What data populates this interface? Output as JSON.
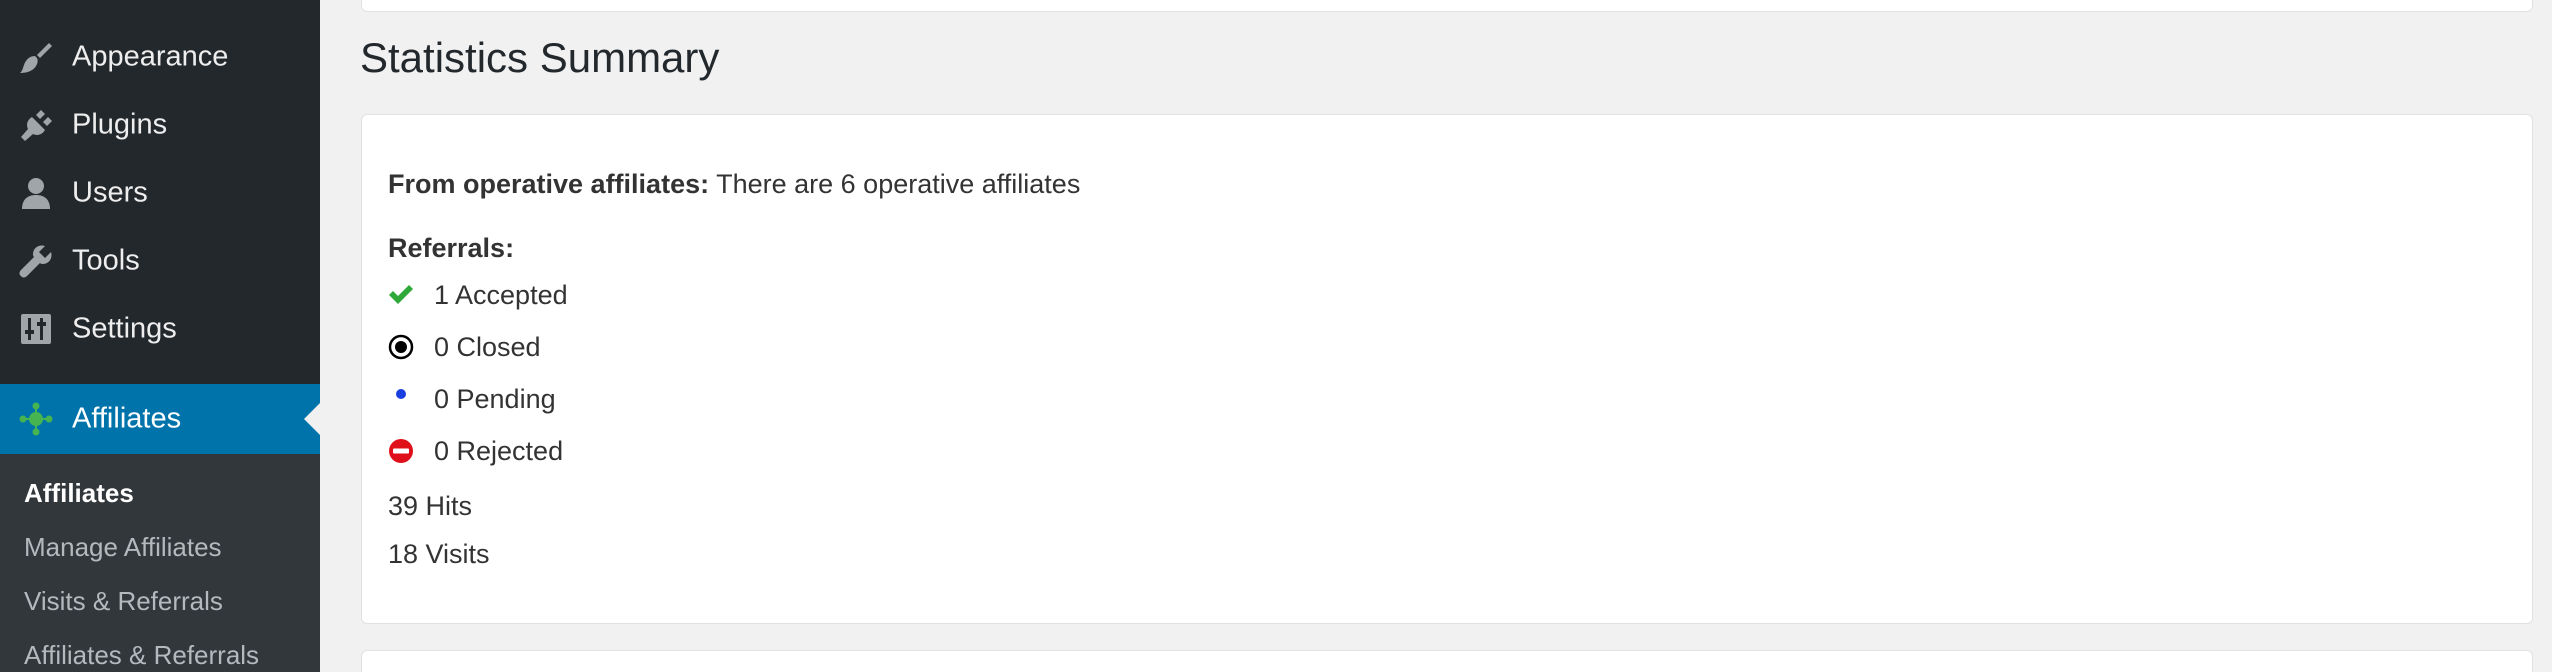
{
  "sidebar": {
    "menu": [
      {
        "label": "Appearance",
        "icon": "paintbrush-icon"
      },
      {
        "label": "Plugins",
        "icon": "plug-icon"
      },
      {
        "label": "Users",
        "icon": "user-icon"
      },
      {
        "label": "Tools",
        "icon": "wrench-icon"
      },
      {
        "label": "Settings",
        "icon": "settings-sliders-icon"
      }
    ],
    "active": {
      "label": "Affiliates",
      "icon": "affiliates-network-icon"
    },
    "submenu": [
      {
        "label": "Affiliates",
        "current": true
      },
      {
        "label": "Manage Affiliates"
      },
      {
        "label": "Visits & Referrals"
      },
      {
        "label": "Affiliates & Referrals"
      }
    ]
  },
  "main": {
    "title": "Statistics Summary",
    "operative": {
      "label": "From operative affiliates:",
      "text": "There are 6 operative affiliates"
    },
    "referrals": {
      "label": "Referrals:",
      "statuses": [
        {
          "text": "1 Accepted",
          "icon": "check-icon",
          "color": "#2ea836"
        },
        {
          "text": "0 Closed",
          "icon": "closed-circle-icon",
          "color": "#000000"
        },
        {
          "text": "0 Pending",
          "icon": "pending-dot-icon",
          "color": "#1a3fe0"
        },
        {
          "text": "0 Rejected",
          "icon": "rejected-minus-icon",
          "color": "#e0101a"
        }
      ]
    },
    "hits": "39 Hits",
    "visits": "18 Visits"
  },
  "colors": {
    "sidebar_bg": "#23282d",
    "submenu_bg": "#32373c",
    "active_bg": "#0073aa",
    "page_bg": "#f1f1f1"
  }
}
